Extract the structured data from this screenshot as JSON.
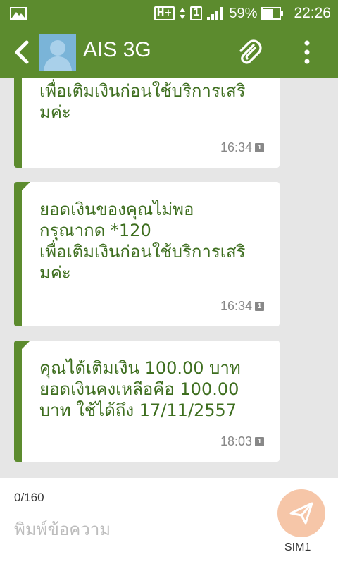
{
  "statusbar": {
    "network": "H+",
    "sim": "1",
    "battery": "59%",
    "time": "22:26",
    "icons": [
      "image-notification-icon",
      "network-type-icon",
      "sim-icon",
      "signal-icon",
      "battery-icon"
    ]
  },
  "appbar": {
    "title": "AIS 3G",
    "icons": [
      "back-arrow-icon",
      "contact-avatar-icon",
      "paperclip-icon",
      "more-vert-icon"
    ]
  },
  "messages": [
    {
      "text": "เพื่อเติมเงินก่อนใช้บริการเสริ\nมค่ะ",
      "time": "16:34",
      "sim": "1"
    },
    {
      "text": "ยอดเงินของคุณไม่พอ\nกรุณากด *120\nเพื่อเติมเงินก่อนใช้บริการเสริ\nมค่ะ",
      "time": "16:34",
      "sim": "1"
    },
    {
      "text": "คุณได้เติมเงิน 100.00 บาท\nยอดเงินคงเหลือคือ 100.00\nบาท ใช้ได้ถึง 17/11/2557",
      "time": "18:03",
      "sim": "1"
    }
  ],
  "compose": {
    "counter": "0/160",
    "placeholder": "พิมพ์ข้อความ",
    "value": "",
    "sim_label": "SIM1"
  },
  "colors": {
    "primary": "#5c8b2e",
    "message_text": "#3e6e1f",
    "send_button": "#f6c6a8"
  }
}
